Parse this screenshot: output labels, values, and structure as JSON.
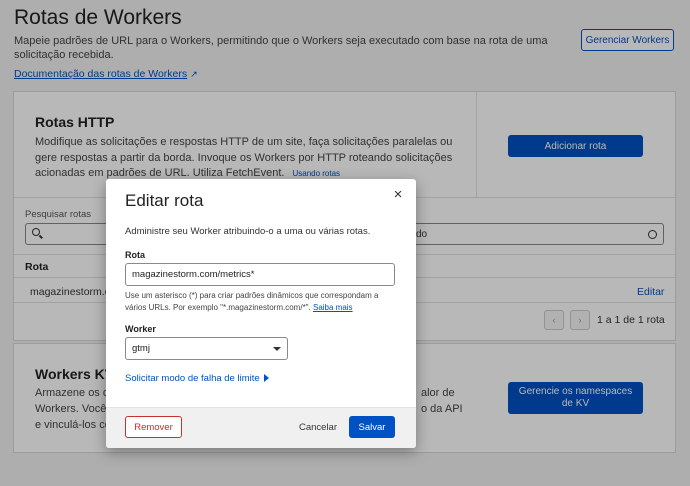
{
  "page": {
    "title": "Rotas de Workers",
    "description": "Mapeie padrões de URL para o Workers, permitindo que o Workers seja executado com base na rota de uma solicitação recebida.",
    "doc_link": "Documentação das rotas de Workers",
    "manage_workers_button": "Gerenciar Workers"
  },
  "http_routes": {
    "title": "Rotas HTTP",
    "description": "Modifique as solicitações e respostas HTTP de um site, faça solicitações paralelas ou gere respostas a partir da borda. Invoque os Workers por HTTP roteando solicitações acionadas em padrões de URL. Utiliza FetchEvent.",
    "using_routes_link": "Usando rotas",
    "add_route_button": "Adicionar rota",
    "search_label": "Pesquisar rotas",
    "filter_value": "do",
    "column_route": "Rota",
    "rows": [
      {
        "route": "magazinestorm.c",
        "action": "Editar"
      }
    ],
    "pager": {
      "prev": "‹",
      "next": "›",
      "text": "1 a 1 de 1 rota"
    }
  },
  "workers_kv": {
    "title": "Workers KV",
    "description_lines": [
      "Armazene os d",
      "Workers. Você p",
      "e vinculá-los co"
    ],
    "description_right_lines": [
      "alor de",
      "o da API"
    ],
    "manage_namespaces_button": "Gerencie os namespaces de KV"
  },
  "modal": {
    "title": "Editar rota",
    "close": "×",
    "description": "Administre seu Worker atribuindo-o a uma ou várias rotas.",
    "route_label": "Rota",
    "route_value": "magazinestorm.com/metrics*",
    "help_text": "Use um asterisco (*) para criar padrões dinâmicos que correspondam a vários URLs. Por exemplo \"*.magazinestorm.com/*\".",
    "learn_more": "Saiba mais",
    "worker_label": "Worker",
    "worker_value": "gtmj",
    "limit_failure_link": "Solicitar modo de falha de limite",
    "remove_button": "Remover",
    "cancel_button": "Cancelar",
    "save_button": "Salvar"
  },
  "colors": {
    "accent": "#0051c3",
    "danger": "#c53030",
    "overlay": "rgba(0,0,0,0.28)"
  }
}
